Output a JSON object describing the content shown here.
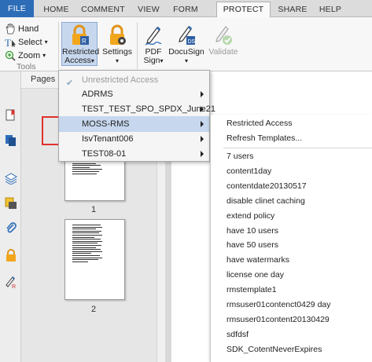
{
  "tabs": [
    {
      "label": "FILE"
    },
    {
      "label": "HOME"
    },
    {
      "label": "COMMENT"
    },
    {
      "label": "VIEW"
    },
    {
      "label": "FORM"
    },
    {
      "label": "PROTECT"
    },
    {
      "label": "SHARE"
    },
    {
      "label": "HELP"
    }
  ],
  "ribbon": {
    "tools": {
      "hand": "Hand",
      "select": "Select",
      "zoom": "Zoom",
      "group_label": "Tools"
    },
    "restricted_access": {
      "line1": "Restricted",
      "line2": "Access"
    },
    "settings": {
      "label": "Settings"
    },
    "pdf_sign": {
      "line1": "PDF",
      "line2": "Sign"
    },
    "docusign": {
      "label": "DocuSign"
    },
    "validate": {
      "label": "Validate"
    }
  },
  "panel": {
    "title": "Pages",
    "page_numbers": [
      "1",
      "2"
    ]
  },
  "menu": {
    "items": [
      {
        "label": "Unrestricted Access",
        "state": "disabled-checked"
      },
      {
        "label": "ADRMS"
      },
      {
        "label": "TEST_TEST_SPO_SPDX_June21"
      },
      {
        "label": "MOSS-RMS",
        "state": "highlighted"
      },
      {
        "label": "IsvTenant006"
      },
      {
        "label": "TEST08-01"
      }
    ]
  },
  "submenu": {
    "items": [
      "Restricted Access",
      "Refresh Templates...",
      "7 users",
      "content1day",
      "contentdate20130517",
      "disable clinet caching",
      "extend policy",
      "have 10 users",
      "have 50 users",
      "have watermarks",
      "license one day",
      "rmstemplate1",
      "rmsuser01contenct0429 day",
      "rmsuser01content20130429",
      "sdfdsf",
      "SDK_CotentNeverExpires"
    ]
  },
  "colors": {
    "file_tab": "#2d6db8",
    "menu_highlight": "#c6d7ee",
    "selection_border": "#e0302a",
    "lock_icon": "#f2a61c"
  }
}
